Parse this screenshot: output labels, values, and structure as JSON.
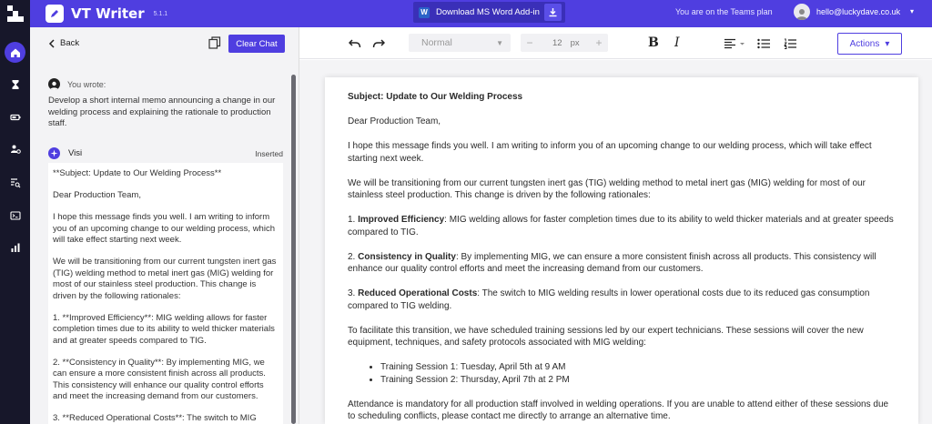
{
  "app": {
    "title": "VT Writer",
    "version": "5.1.1",
    "word_addin_label": "Download MS Word Add-in",
    "plan_text": "You are on the Teams plan",
    "user_email": "hello@luckydave.co.uk"
  },
  "rail": {
    "items": [
      "home-icon",
      "hourglass-icon",
      "battery-icon",
      "users-cog-icon",
      "search-list-icon",
      "terminal-icon",
      "bar-chart-icon"
    ],
    "active": "home-icon"
  },
  "chat": {
    "back_label": "Back",
    "clear_label": "Clear Chat",
    "you_wrote_label": "You wrote:",
    "prompt": "Develop a short internal memo announcing a change in our welding process and explaining the rationale to production staff.",
    "assistant_name": "Visi",
    "inserted_label": "Inserted",
    "response": [
      "**Subject: Update to Our Welding Process**",
      "Dear Production Team,",
      "I hope this message finds you well. I am writing to inform you of an upcoming change to our welding process, which will take effect starting next week.",
      "We will be transitioning from our current tungsten inert gas (TIG) welding method to metal inert gas (MIG) welding for most of our stainless steel production. This change is driven by the following rationales:",
      "1. **Improved Efficiency**: MIG welding allows for faster completion times due to its ability to weld thicker materials and at greater speeds compared to TIG.",
      "2. **Consistency in Quality**: By implementing MIG, we can ensure a more consistent finish across all products. This consistency will enhance our quality control efforts and meet the increasing demand from our customers.",
      "3. **Reduced Operational Costs**: The switch to MIG"
    ]
  },
  "toolbar": {
    "style_value": "Normal",
    "font_size": "12",
    "font_unit": "px",
    "minus": "−",
    "plus": "+",
    "bold": "B",
    "italic": "I",
    "actions_label": "Actions"
  },
  "document": {
    "subject": "Subject: Update to Our Welding Process",
    "greeting": "Dear Production Team,",
    "intro": "I hope this message finds you well. I am writing to inform you of an upcoming change to our welding process, which will take effect starting next week.",
    "transition": "We will be transitioning from our current tungsten inert gas (TIG) welding method to metal inert gas (MIG) welding for most of our stainless steel production. This change is driven by the following rationales:",
    "points": [
      {
        "prefix": "1. ",
        "heading": "Improved Efficiency",
        "text": ": MIG welding allows for faster completion times due to its ability to weld thicker materials and at greater speeds compared to TIG."
      },
      {
        "prefix": "2. ",
        "heading": "Consistency in Quality",
        "text": ": By implementing MIG, we can ensure a more consistent finish across all products. This consistency will enhance our quality control efforts and meet the increasing demand from our customers."
      },
      {
        "prefix": "3. ",
        "heading": "Reduced Operational Costs",
        "text": ": The switch to MIG welding results in lower operational costs due to its reduced gas consumption compared to TIG welding."
      }
    ],
    "training_intro": "To facilitate this transition, we have scheduled training sessions led by our expert technicians. These sessions will cover the new equipment, techniques, and safety protocols associated with MIG welding:",
    "sessions": [
      "Training Session 1: Tuesday, April 5th at 9 AM",
      "Training Session 2: Thursday, April 7th at 2 PM"
    ],
    "attendance": "Attendance is mandatory for all production staff involved in welding operations. If you are unable to attend either of these sessions due to scheduling conflicts, please contact me directly to arrange an alternative time."
  },
  "colors": {
    "accent": "#4f3ee0",
    "rail_bg": "#17172a",
    "chat_bg": "#f3f3f5"
  }
}
